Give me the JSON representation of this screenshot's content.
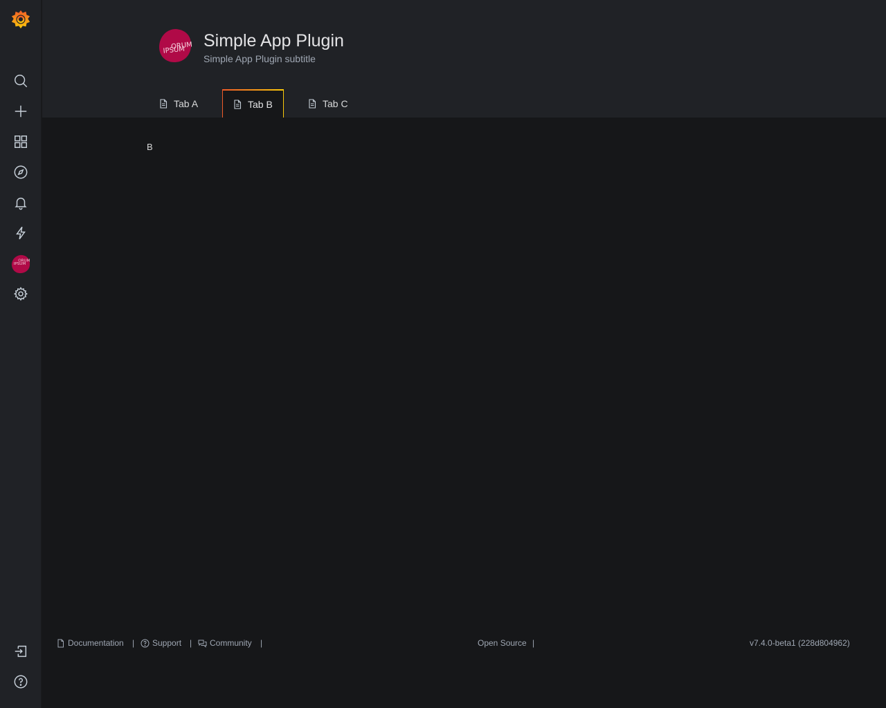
{
  "sidemenu": {
    "items": [
      {
        "icon": "search-icon"
      },
      {
        "icon": "plus-icon"
      },
      {
        "icon": "dashboards-icon"
      },
      {
        "icon": "explore-compass-icon"
      },
      {
        "icon": "bell-icon"
      },
      {
        "icon": "lightning-icon"
      },
      {
        "icon": "plugin-logo-icon"
      },
      {
        "icon": "gear-icon"
      }
    ],
    "bottom": [
      {
        "icon": "sign-in-icon"
      },
      {
        "icon": "help-icon"
      }
    ]
  },
  "header": {
    "logo_text": "LOREM IPSUM",
    "title": "Simple App Plugin",
    "subtitle": "Simple App Plugin subtitle"
  },
  "tabs": [
    {
      "label": "Tab A",
      "active": false
    },
    {
      "label": "Tab B",
      "active": true
    },
    {
      "label": "Tab C",
      "active": false
    }
  ],
  "content": {
    "text": "B"
  },
  "footer": {
    "documentation": "Documentation",
    "support": "Support",
    "community": "Community",
    "open_source": "Open Source",
    "version": "v7.4.0-beta1 (228d804962)",
    "separator": "|"
  },
  "colors": {
    "accent_gradient_start": "#f05a28",
    "accent_gradient_end": "#fbca0a",
    "plugin_logo": "#b00a47"
  }
}
